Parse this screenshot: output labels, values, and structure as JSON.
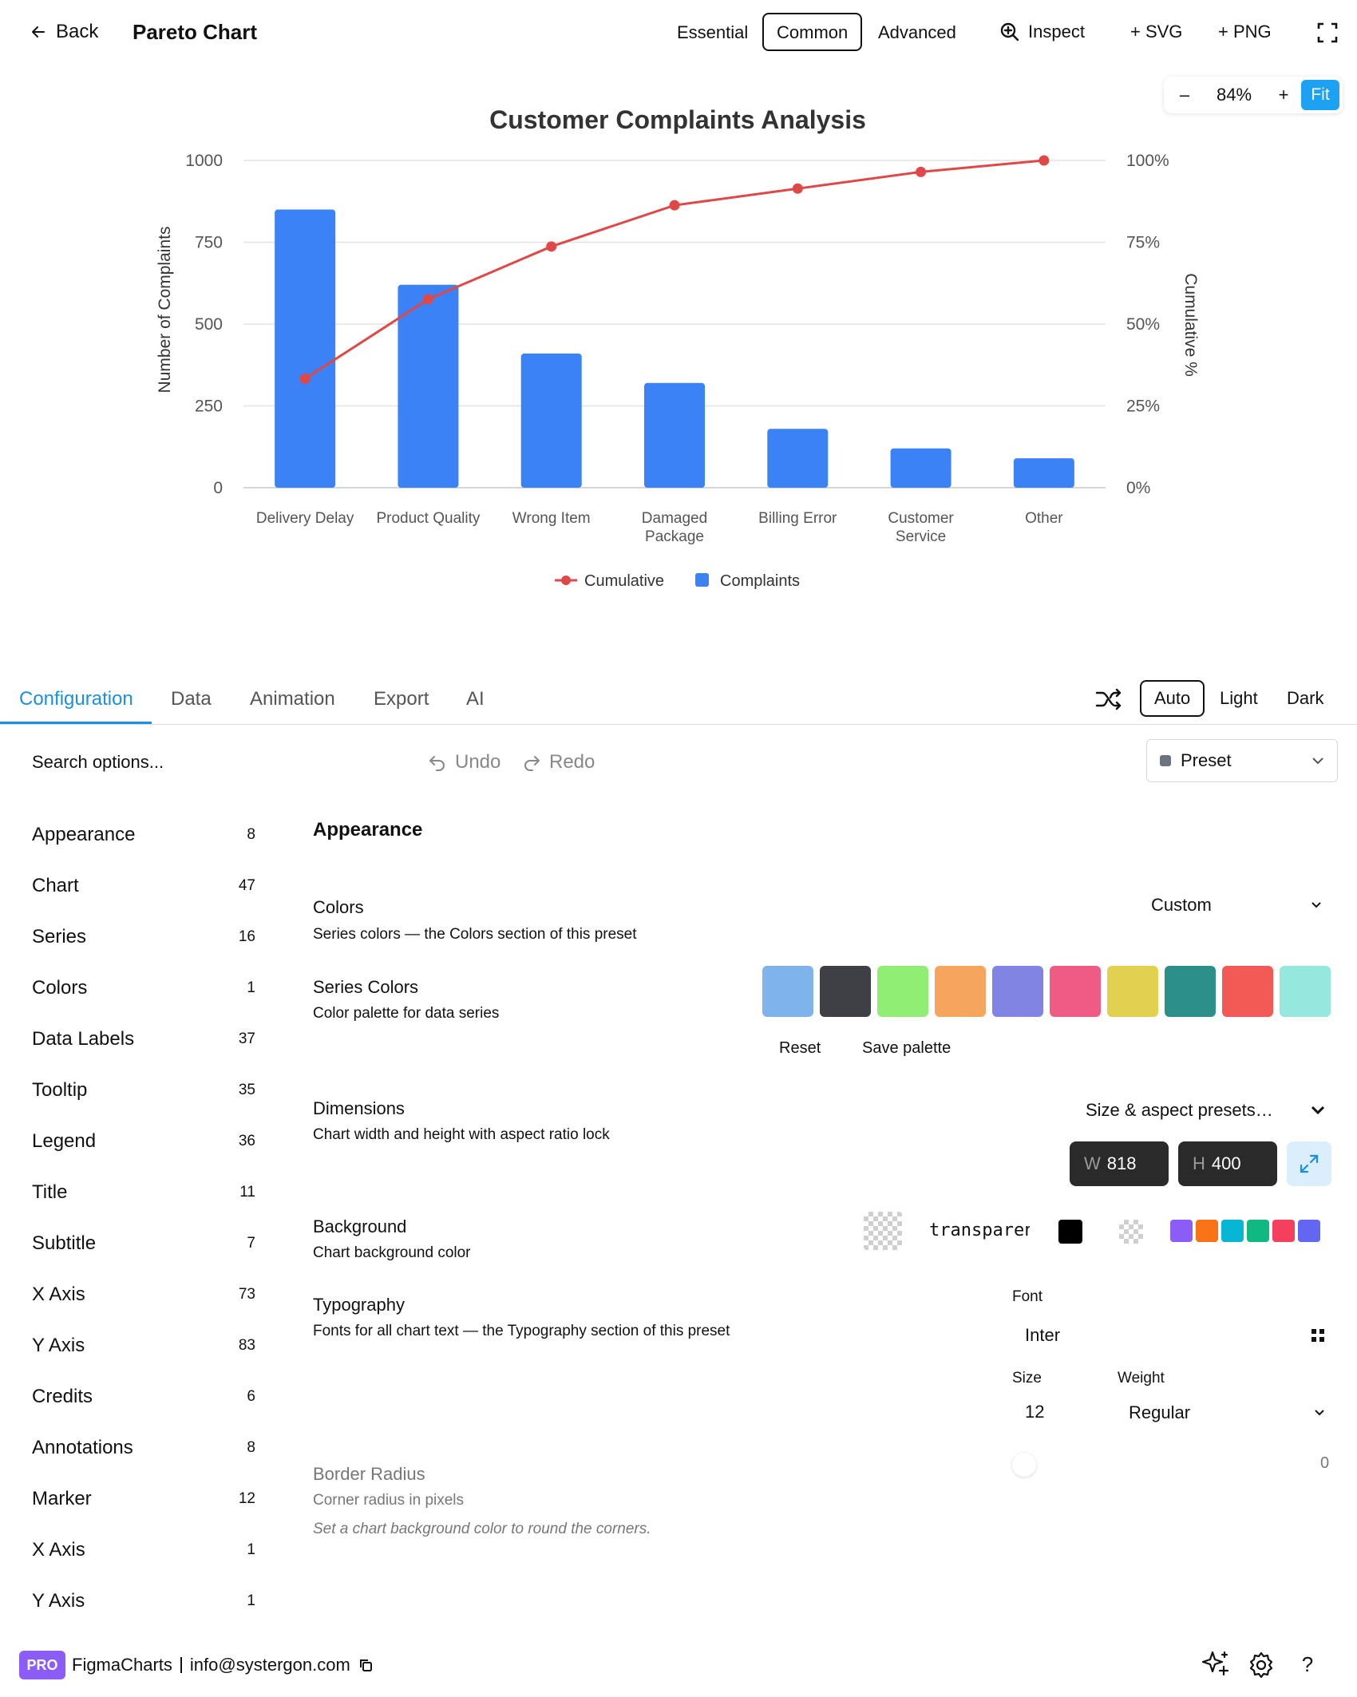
{
  "topbar": {
    "back_label": "Back",
    "title": "Pareto Chart",
    "modes": [
      "Essential",
      "Common",
      "Advanced"
    ],
    "active_mode": "Common",
    "inspect_label": "Inspect",
    "svg_label": "+ SVG",
    "png_label": "+ PNG"
  },
  "zoom": {
    "minus": "–",
    "level": "84%",
    "plus": "+",
    "fit": "Fit"
  },
  "chart_data": {
    "type": "bar",
    "title": "Customer Complaints Analysis",
    "categories": [
      "Delivery Delay",
      "Product Quality",
      "Wrong Item",
      "Damaged Package",
      "Billing Error",
      "Customer Service",
      "Other"
    ],
    "category_lines": [
      [
        "Delivery Delay"
      ],
      [
        "Product Quality"
      ],
      [
        "Wrong Item"
      ],
      [
        "Damaged",
        "Package"
      ],
      [
        "Billing Error"
      ],
      [
        "Customer",
        "Service"
      ],
      [
        "Other"
      ]
    ],
    "series": [
      {
        "name": "Complaints",
        "type": "bar",
        "axis": "left",
        "color": "#3b82f6",
        "values": [
          850,
          620,
          410,
          320,
          180,
          120,
          90
        ]
      },
      {
        "name": "Cumulative",
        "type": "line",
        "axis": "right",
        "color": "#e04848",
        "values": [
          33.3,
          57.6,
          73.7,
          86.3,
          91.4,
          96.5,
          100
        ]
      }
    ],
    "ylabel": "Number of Complaints",
    "y2label": "Cumulative %",
    "ylim": [
      0,
      1000
    ],
    "y2lim": [
      0,
      100
    ],
    "yticks": [
      "0",
      "250",
      "500",
      "750",
      "1000"
    ],
    "y2ticks": [
      "0%",
      "25%",
      "50%",
      "75%",
      "100%"
    ],
    "legend": [
      "Cumulative",
      "Complaints"
    ],
    "legend_position": "bottom-center",
    "grid": true
  },
  "config_tabs": [
    "Configuration",
    "Data",
    "Animation",
    "Export",
    "AI"
  ],
  "active_config_tab": "Configuration",
  "theme": {
    "options": [
      "Auto",
      "Light",
      "Dark"
    ],
    "active": "Auto"
  },
  "toolbar": {
    "search_placeholder": "Search options...",
    "undo": "Undo",
    "redo": "Redo",
    "preset": "Preset"
  },
  "sidebar": {
    "items": [
      {
        "label": "Appearance",
        "count": "8"
      },
      {
        "label": "Chart",
        "count": "47"
      },
      {
        "label": "Series",
        "count": "16"
      },
      {
        "label": "Colors",
        "count": "1"
      },
      {
        "label": "Data Labels",
        "count": "37"
      },
      {
        "label": "Tooltip",
        "count": "35"
      },
      {
        "label": "Legend",
        "count": "36"
      },
      {
        "label": "Title",
        "count": "11"
      },
      {
        "label": "Subtitle",
        "count": "7"
      },
      {
        "label": "X Axis",
        "count": "73"
      },
      {
        "label": "Y Axis",
        "count": "83"
      },
      {
        "label": "Credits",
        "count": "6"
      },
      {
        "label": "Annotations",
        "count": "8"
      },
      {
        "label": "Marker",
        "count": "12"
      },
      {
        "label": "X Axis",
        "count": "1"
      },
      {
        "label": "Y Axis",
        "count": "1"
      }
    ]
  },
  "appearance": {
    "section_title": "Appearance",
    "colors": {
      "title": "Colors",
      "desc": "Series colors — the Colors section of this preset",
      "value": "Custom"
    },
    "series_colors": {
      "title": "Series Colors",
      "desc": "Color palette for data series",
      "palette": [
        "#7eb3ec",
        "#3f3f46",
        "#90ee74",
        "#f6a55c",
        "#8284e4",
        "#ef5b84",
        "#e1d14f",
        "#2c8f88",
        "#f35a55",
        "#94e8de"
      ],
      "reset": "Reset",
      "save": "Save palette"
    },
    "dimensions": {
      "title": "Dimensions",
      "desc": "Chart width and height with aspect ratio lock",
      "presets": "Size & aspect presets…",
      "w_label": "W",
      "w": "818",
      "h_label": "H",
      "h": "400"
    },
    "background": {
      "title": "Background",
      "desc": "Chart background color",
      "value": "transparent",
      "quick_colors": [
        "#8b5cf6",
        "#f97316",
        "#06b6d4",
        "#10b981",
        "#f43f5e",
        "#6366f1"
      ]
    },
    "typography": {
      "title": "Typography",
      "desc": "Fonts for all chart text — the Typography section of this preset",
      "font_label": "Font",
      "font": "Inter",
      "size_label": "Size",
      "size": "12",
      "weight_label": "Weight",
      "weight": "Regular"
    },
    "border_radius": {
      "title": "Border Radius",
      "desc": "Corner radius in pixels",
      "hint": "Set a chart background color to round the corners.",
      "value": "0"
    }
  },
  "footer": {
    "badge": "PRO",
    "brand": "FigmaCharts",
    "email": "info@systergon.com"
  }
}
